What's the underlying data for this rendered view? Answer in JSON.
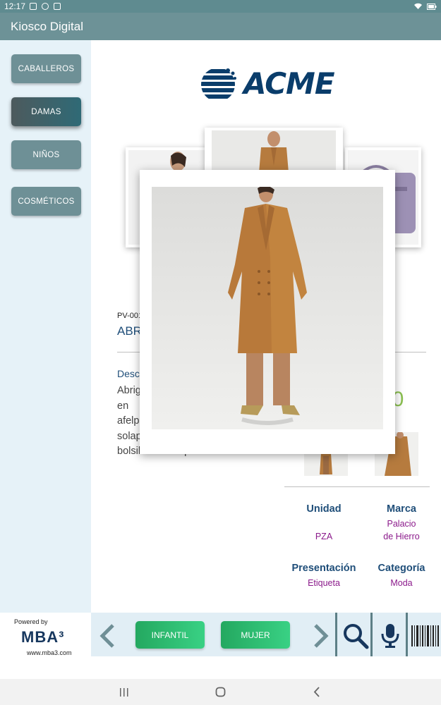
{
  "status_bar": {
    "time": "12:17"
  },
  "app": {
    "title": "Kiosco Digital"
  },
  "sidebar": {
    "items": [
      {
        "label": "CABALLEROS",
        "active": false
      },
      {
        "label": "DAMAS",
        "active": true
      },
      {
        "label": "NIÑOS",
        "active": false
      },
      {
        "label": "COSMÉTICOS",
        "active": false
      }
    ]
  },
  "brand": {
    "logo_text": "ACME"
  },
  "product": {
    "sku": "PV-001",
    "name": "ABR",
    "description_title": "Desc",
    "description_lines": [
      "Abrig",
      "en",
      "afelp",
      "solap",
      "bolsillos con tapeta."
    ],
    "price": "00",
    "attributes": {
      "unidad_label": "Unidad",
      "unidad_value": "PZA",
      "marca_label": "Marca",
      "marca_value": "Palacio de Hierro",
      "presentacion_label": "Presentación",
      "presentacion_value": "Etiqueta",
      "categoria_label": "Categoría",
      "categoria_value": "Moda"
    }
  },
  "footer": {
    "powered_by": "Powered by",
    "mba_logo": "MBA³",
    "mba_url": "www.mba3.com",
    "tags": [
      "INFANTIL",
      "MUJER"
    ]
  },
  "colors": {
    "accent": "#6d9297",
    "price": "#8cc152",
    "attribute_value": "#8b1a8b",
    "tag_button": "#2fbf74"
  }
}
